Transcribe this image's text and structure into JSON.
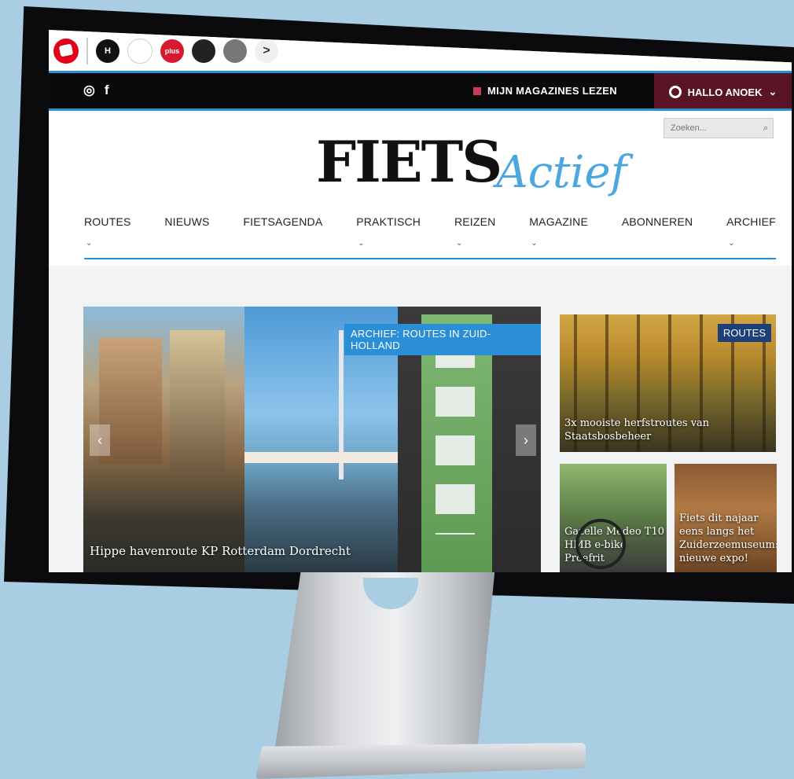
{
  "brandbar": {
    "publications": [
      "H",
      "",
      "plus",
      "",
      "",
      ">"
    ]
  },
  "topbar": {
    "social": [
      "instagram-icon",
      "f"
    ],
    "magazines_label": "MIJN MAGAZINES LEZEN",
    "hello_label": "HALLO ANOEK",
    "hello_caret": "⌄"
  },
  "search": {
    "placeholder": "Zoeken..."
  },
  "logo": {
    "main": "FIETS",
    "script": "Actief"
  },
  "nav": [
    {
      "label": "ROUTES",
      "dropdown": true
    },
    {
      "label": "NIEUWS",
      "dropdown": false
    },
    {
      "label": "FIETSAGENDA",
      "dropdown": false
    },
    {
      "label": "PRAKTISCH",
      "dropdown": true
    },
    {
      "label": "REIZEN",
      "dropdown": true
    },
    {
      "label": "MAGAZINE",
      "dropdown": true
    },
    {
      "label": "ABONNEREN",
      "dropdown": false
    },
    {
      "label": "ARCHIEF",
      "dropdown": true
    }
  ],
  "hero": {
    "tag": "ARCHIEF: ROUTES IN ZUID-HOLLAND",
    "caption": "Hippe havenroute KP Rotterdam Dordrecht"
  },
  "cards": {
    "forest": {
      "tag": "ROUTES",
      "caption": "3x mooiste herfstroutes van Staatsbosbeheer"
    },
    "bike": {
      "caption": "Gazelle Medeo T10 HMB e-bike Proefrit"
    },
    "museum": {
      "caption": "Fiets dit najaar eens langs het Zuiderzeemuseum: nieuwe expo!"
    }
  },
  "colors": {
    "accent": "#2a8fd6",
    "hello_bg": "#5a1428",
    "routes_tag": "#1f3f7a"
  }
}
